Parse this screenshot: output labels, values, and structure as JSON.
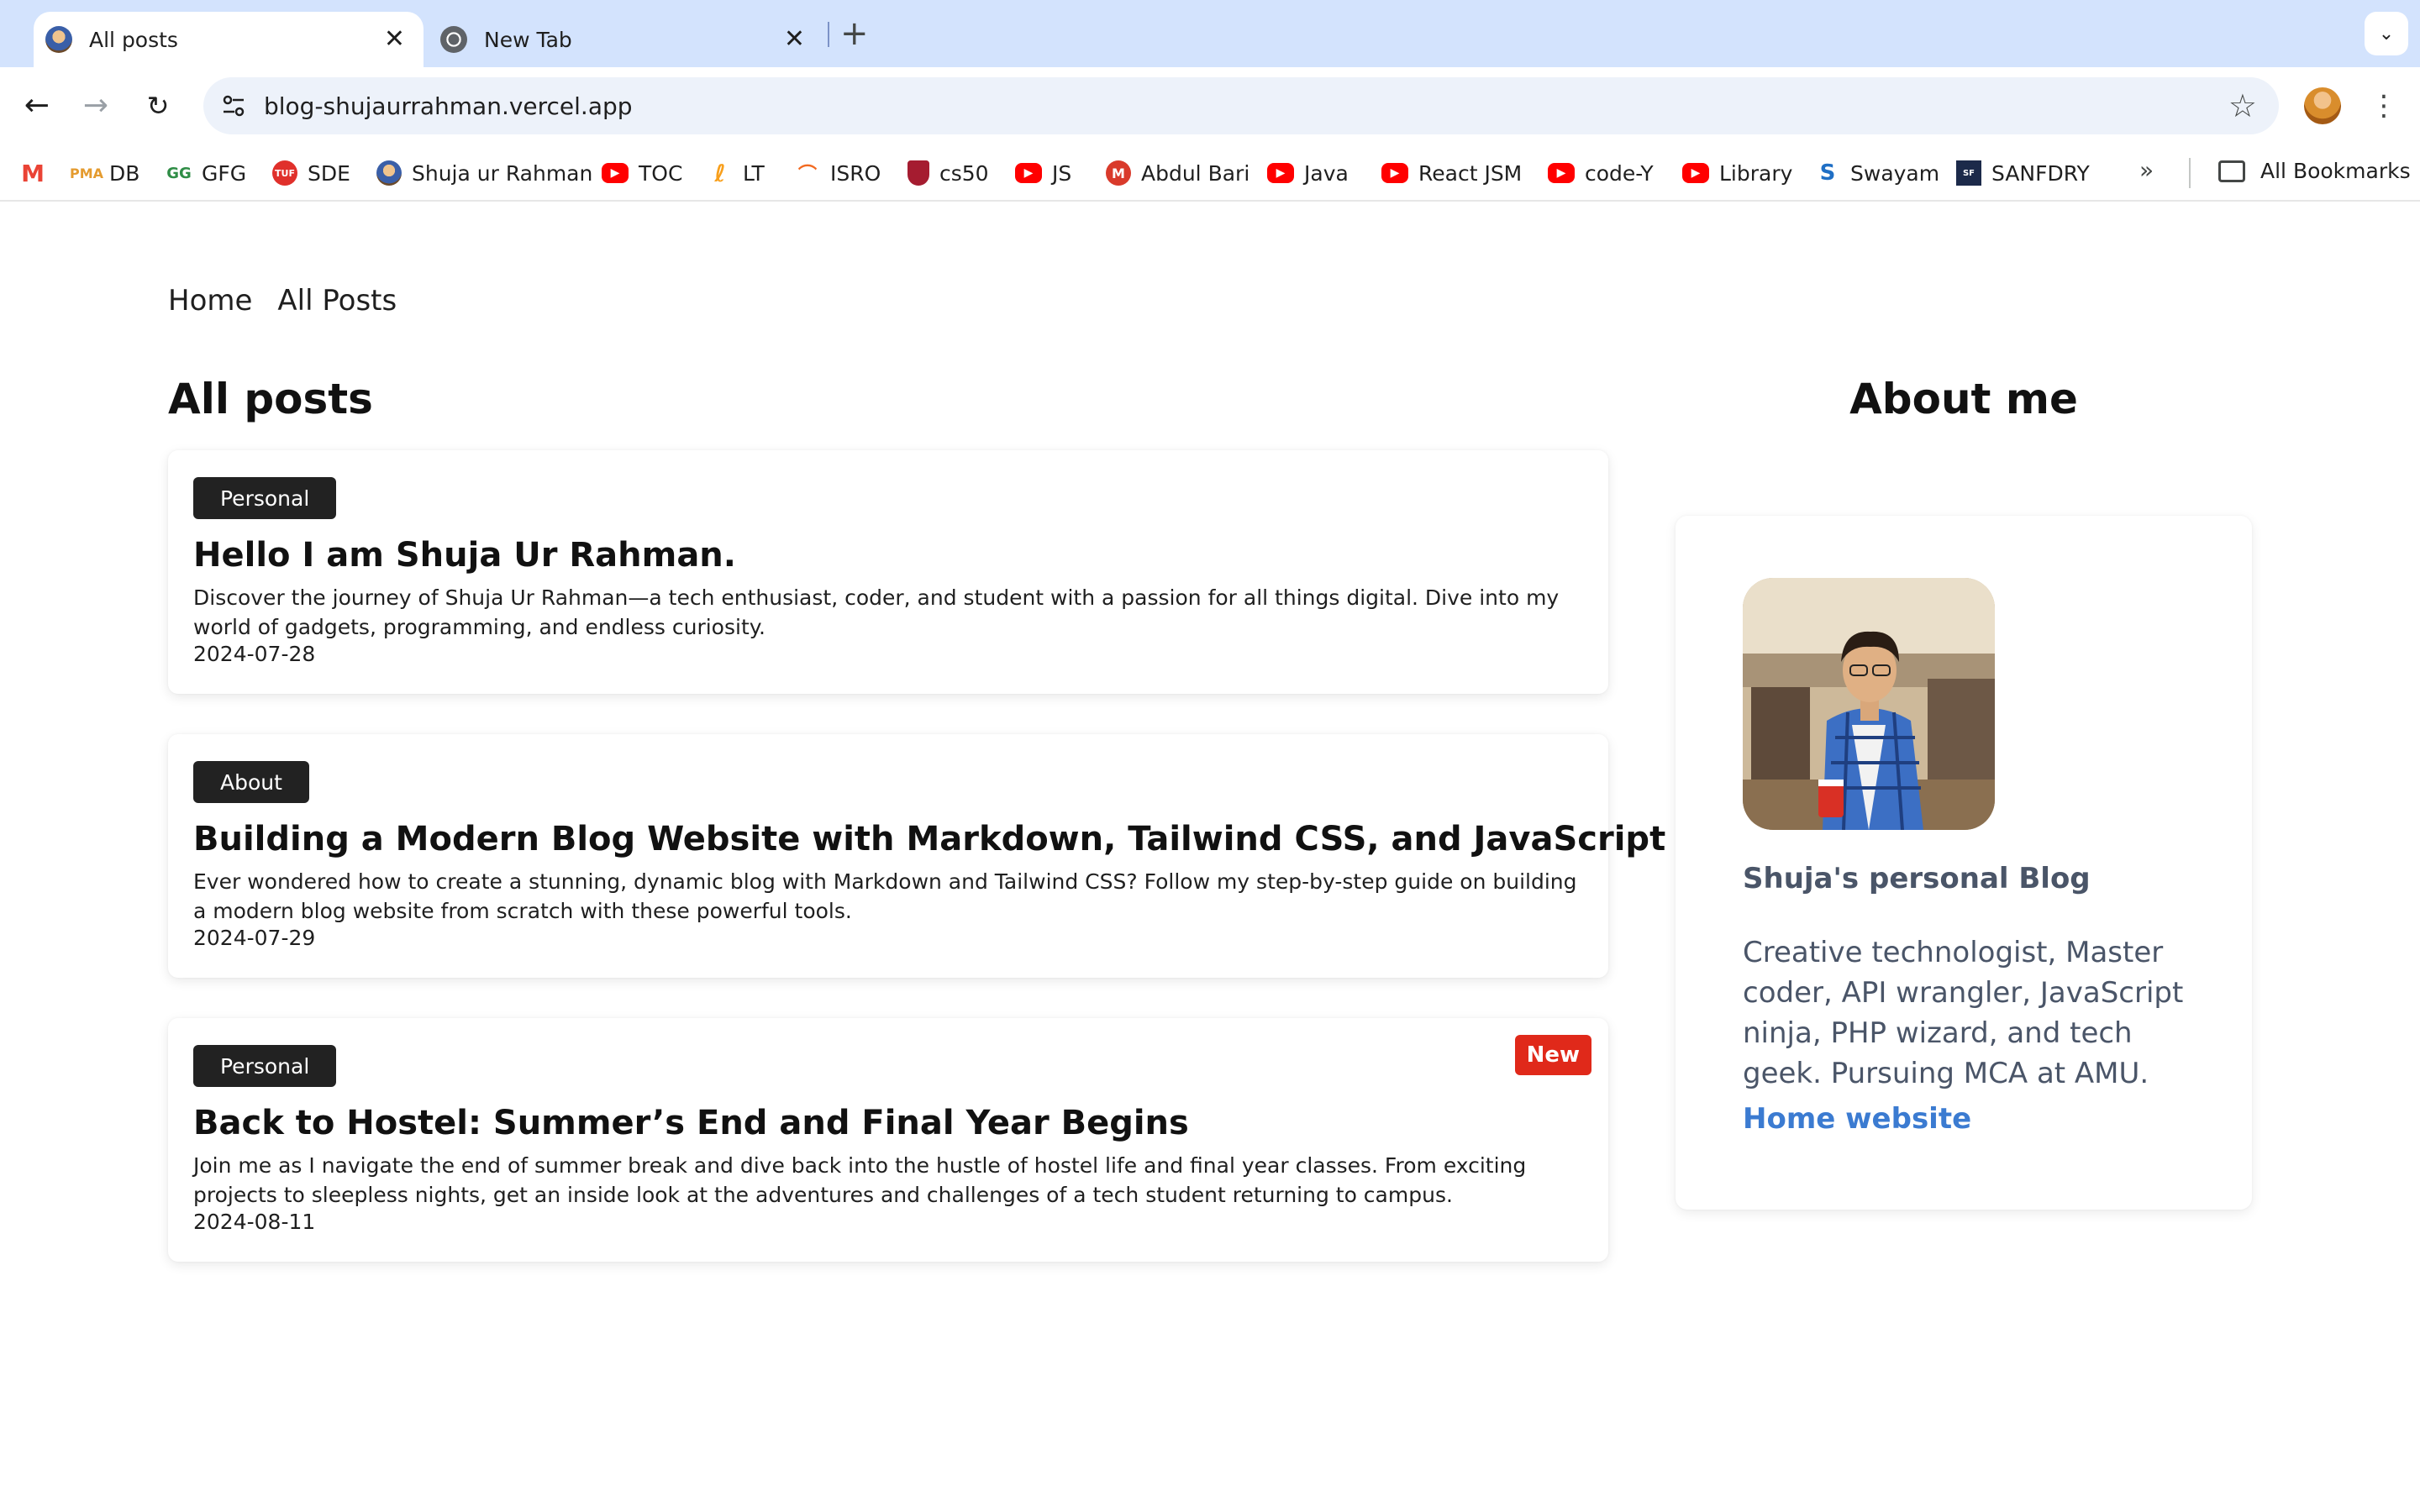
{
  "browser": {
    "tabs": [
      {
        "title": "All posts",
        "active": true
      },
      {
        "title": "New Tab",
        "active": false
      }
    ],
    "url": "blog-shujaurrahman.vercel.app",
    "bookmarks": [
      {
        "label": "",
        "icon": "gmail-icon"
      },
      {
        "label": "DB",
        "icon": "pma-icon"
      },
      {
        "label": "GFG",
        "icon": "gfg-icon"
      },
      {
        "label": "SDE",
        "icon": "tuf-icon"
      },
      {
        "label": "Shuja ur Rahman",
        "icon": "profile-icon"
      },
      {
        "label": "TOC",
        "icon": "youtube-icon"
      },
      {
        "label": "LT",
        "icon": "leetcode-icon"
      },
      {
        "label": "ISRO",
        "icon": "isro-icon"
      },
      {
        "label": "cs50",
        "icon": "harvard-icon"
      },
      {
        "label": "JS",
        "icon": "youtube-icon"
      },
      {
        "label": "Abdul Bari",
        "icon": "udemy-icon"
      },
      {
        "label": "Java",
        "icon": "youtube-icon"
      },
      {
        "label": "React JSM",
        "icon": "youtube-icon"
      },
      {
        "label": "code-Y",
        "icon": "youtube-icon"
      },
      {
        "label": "Library",
        "icon": "youtube-icon"
      },
      {
        "label": "Swayam",
        "icon": "swayam-icon"
      },
      {
        "label": "SANFDRY",
        "icon": "sanfdry-icon"
      }
    ],
    "overflow_label": "»",
    "all_bookmarks_label": "All Bookmarks"
  },
  "site": {
    "nav": [
      "Home",
      "All Posts"
    ],
    "posts_heading": "All posts",
    "posts": [
      {
        "tag": "Personal",
        "title": "Hello I am Shuja Ur Rahman.",
        "description": "Discover the journey of Shuja Ur Rahman—a tech enthusiast, coder, and student with a passion for all things digital. Dive into my world of gadgets, programming, and endless curiosity.",
        "date": "2024-07-28",
        "badge": ""
      },
      {
        "tag": "About",
        "title": "Building a Modern Blog Website with Markdown, Tailwind CSS, and JavaScript",
        "description": "Ever wondered how to create a stunning, dynamic blog with Markdown and Tailwind CSS? Follow my step-by-step guide on building a modern blog website from scratch with these powerful tools.",
        "date": "2024-07-29",
        "badge": ""
      },
      {
        "tag": "Personal",
        "title": "Back to Hostel: Summer’s End and Final Year Begins",
        "description": "Join me as I navigate the end of summer break and dive back into the hustle of hostel life and final year classes. From exciting projects to sleepless nights, get an inside look at the adventures and challenges of a tech student returning to campus.",
        "date": "2024-08-11",
        "badge": "New"
      }
    ],
    "about": {
      "heading": "About me",
      "name": "Shuja's personal Blog",
      "bio": "Creative technologist, Master coder, API wrangler, JavaScript ninja, PHP wizard, and tech geek. Pursuing MCA at AMU.",
      "link_label": "Home website"
    }
  },
  "colors": {
    "tabstrip": "#d3e3fd",
    "omnibox": "#edf2fa",
    "tag_bg": "#222222",
    "new_badge": "#e0291a",
    "about_text": "#4a5568",
    "link": "#3b7bd1"
  }
}
